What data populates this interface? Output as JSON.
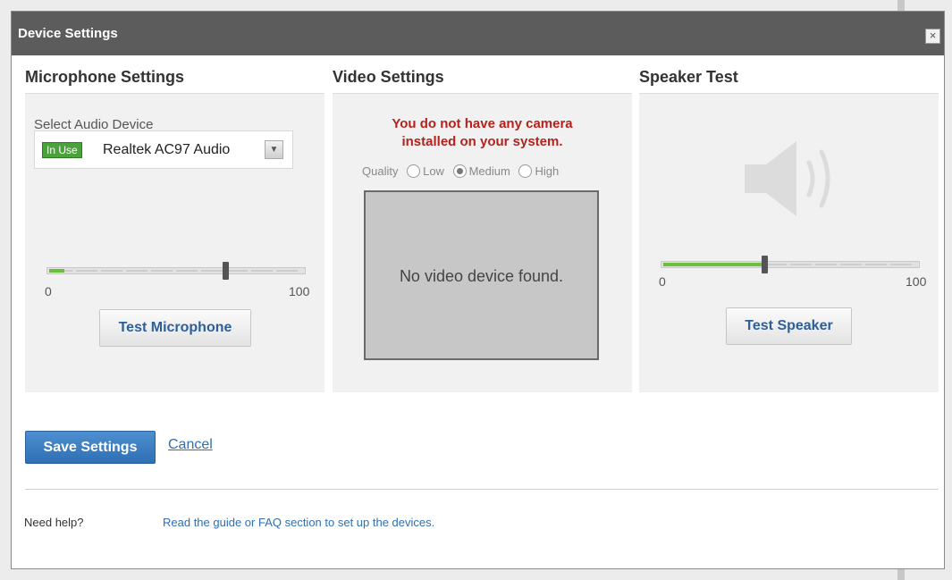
{
  "dialog": {
    "title": "Device Settings",
    "close_glyph": "×"
  },
  "microphone": {
    "heading": "Microphone Settings",
    "select_label": "Select Audio Device",
    "in_use_badge": "In Use",
    "selected_device": "Realtek AC97 Audio",
    "dropdown_icon": "chevron-down-icon",
    "level_fraction": 0.06,
    "slider_position_fraction": 0.69,
    "tick_min": "0",
    "tick_max": "100",
    "test_button": "Test Microphone"
  },
  "video": {
    "heading": "Video Settings",
    "warning_line1": "You do not have any camera",
    "warning_line2": "installed on your system.",
    "quality_label": "Quality",
    "quality_options": [
      "Low",
      "Medium",
      "High"
    ],
    "quality_selected": "Medium",
    "no_device_message": "No video device found."
  },
  "speaker": {
    "heading": "Speaker Test",
    "icon": "speaker-icon",
    "level_fraction": 0.4,
    "slider_position_fraction": 0.4,
    "tick_min": "0",
    "tick_max": "100",
    "test_button": "Test Speaker"
  },
  "footer": {
    "save_button": "Save Settings",
    "cancel_link": "Cancel",
    "help_label": "Need help?",
    "help_link": "Read the guide or FAQ section to set up the devices."
  },
  "colors": {
    "titlebar": "#5c5c5c",
    "accent_blue": "#2f6fb4",
    "warning_red": "#b3221c",
    "level_green": "#6bbf3a"
  }
}
